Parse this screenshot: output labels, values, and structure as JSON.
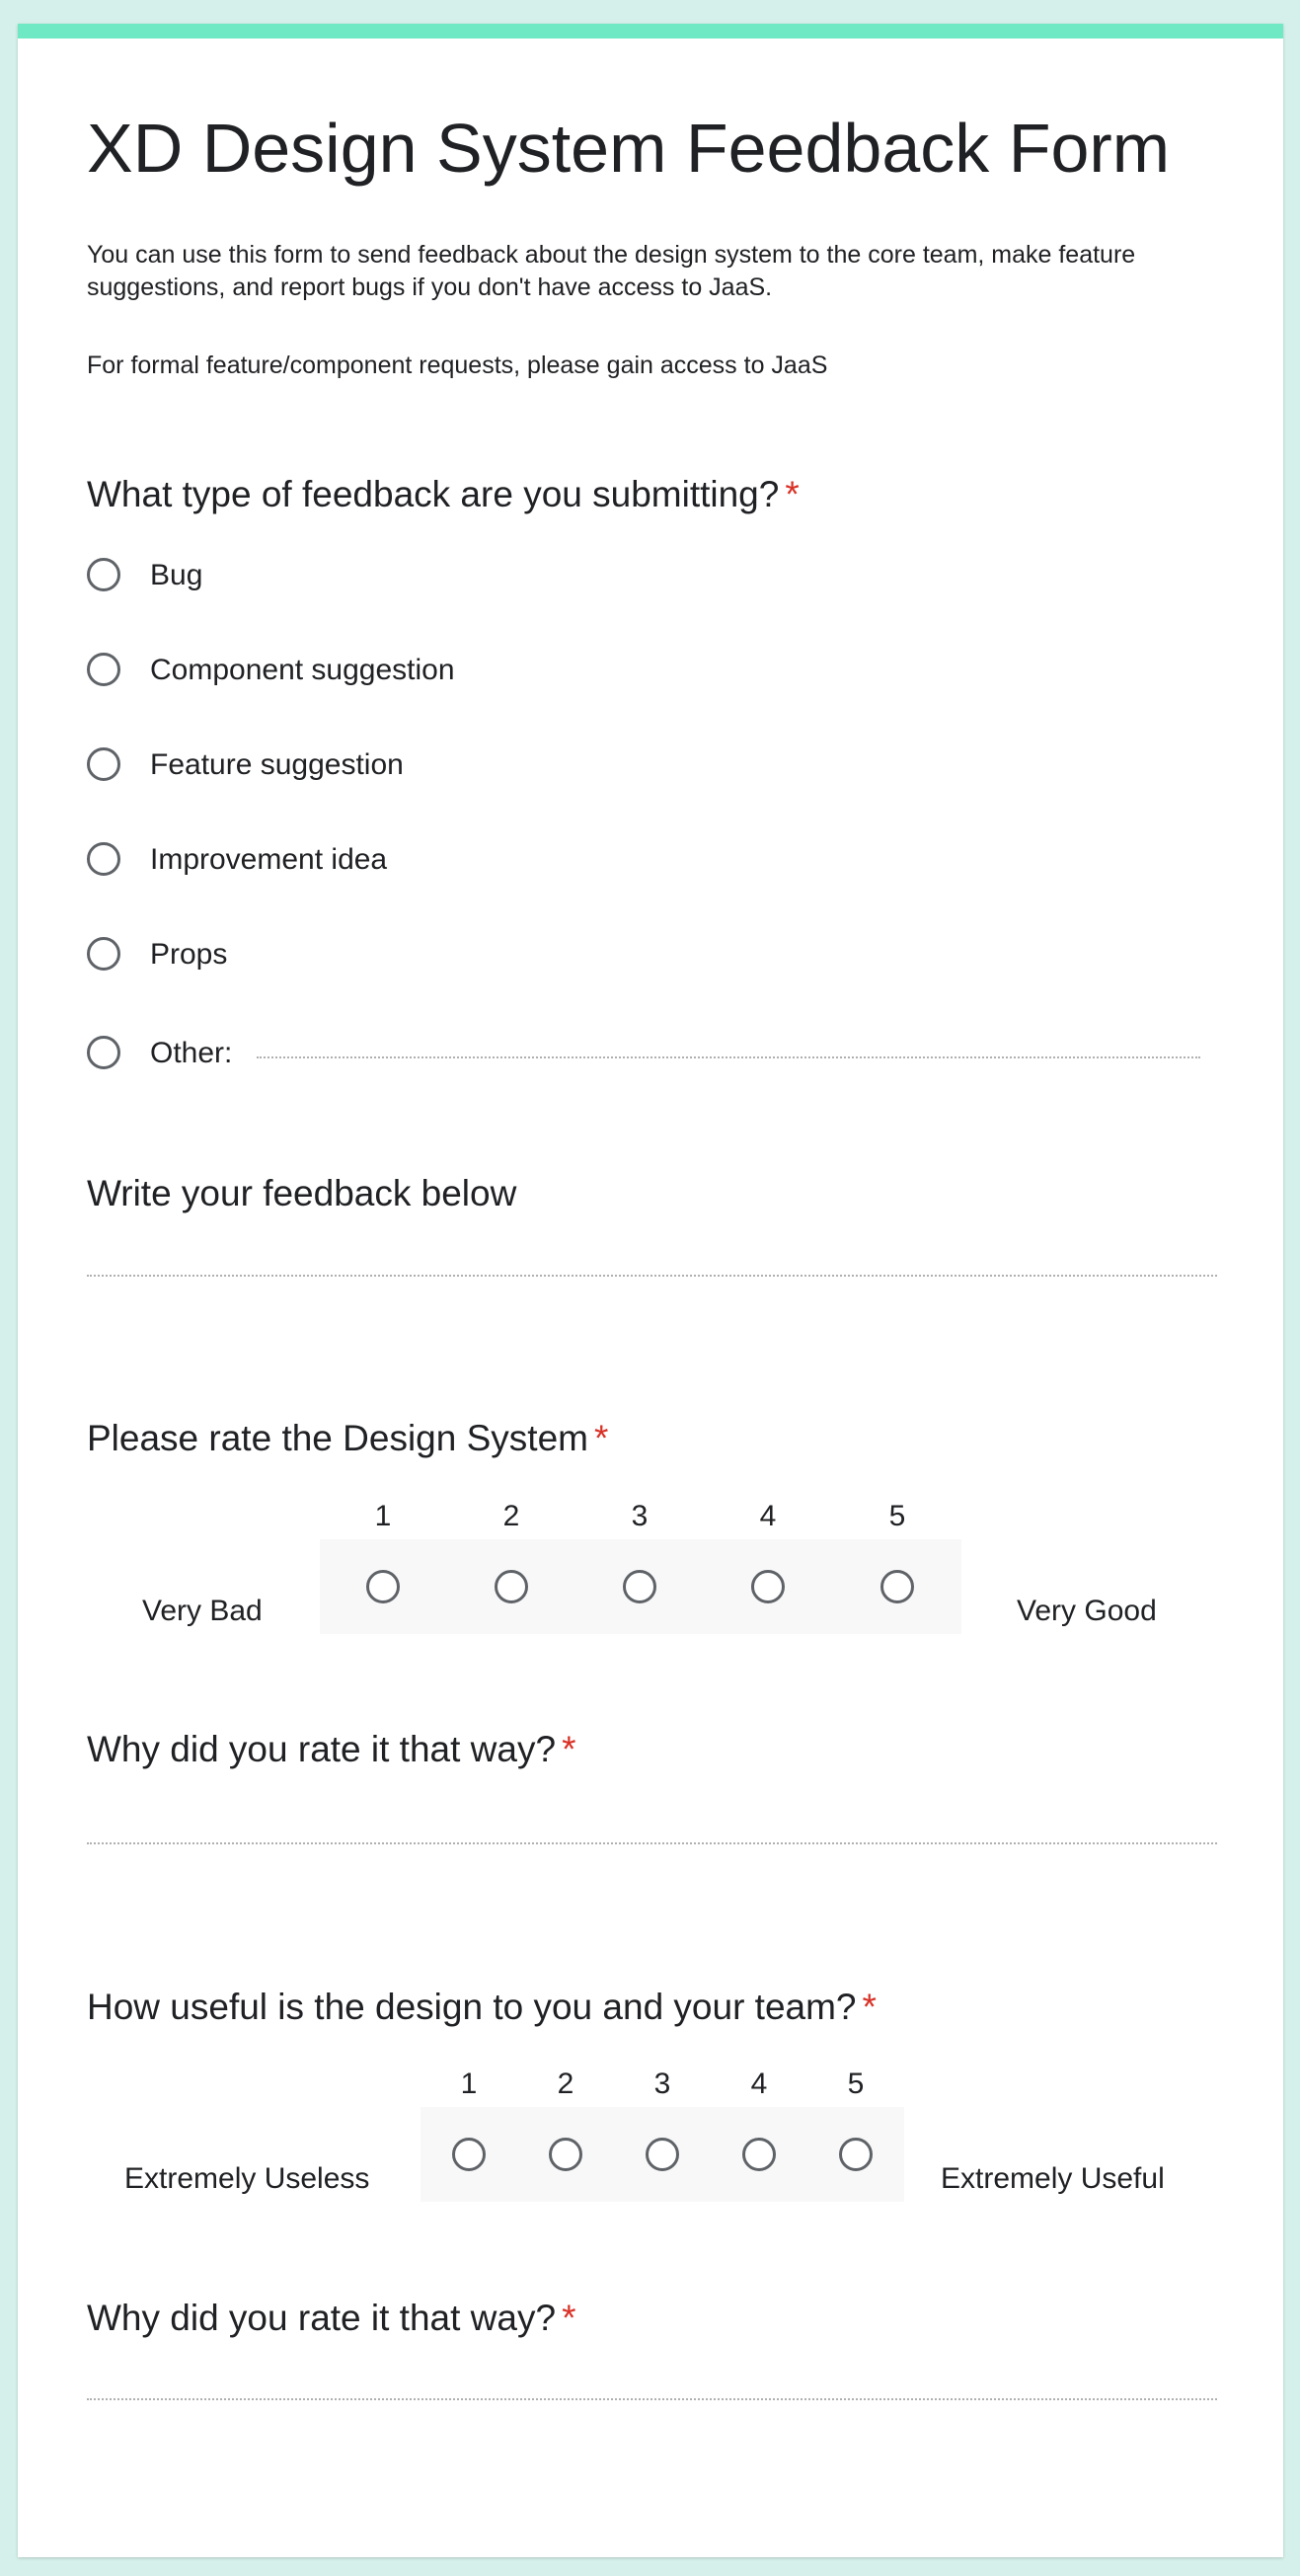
{
  "form": {
    "title": "XD Design System Feedback Form",
    "description_1": "You can use this form to send feedback about the design system to the core team, make feature suggestions, and report bugs if you don't have access to JaaS.",
    "description_2": "For formal feature/component requests, please gain access to JaaS",
    "required_mark": "*"
  },
  "q_type": {
    "title": "What type of feedback are you submitting?",
    "options": [
      "Bug",
      "Component suggestion",
      "Feature suggestion",
      "Improvement idea",
      "Props"
    ],
    "other_label": "Other:",
    "other_value": ""
  },
  "q_feedback": {
    "title": "Write your feedback below",
    "value": ""
  },
  "q_rating": {
    "title": "Please rate the Design System",
    "scale": [
      "1",
      "2",
      "3",
      "4",
      "5"
    ],
    "low_label": "Very Bad",
    "high_label": "Very Good"
  },
  "q_rating_why": {
    "title": "Why did you rate it that way?",
    "value": ""
  },
  "q_useful": {
    "title": "How useful is the design to you and your team?",
    "scale": [
      "1",
      "2",
      "3",
      "4",
      "5"
    ],
    "low_label": "Extremely Useless",
    "high_label": "Extremely Useful"
  },
  "q_useful_why": {
    "title": "Why did you rate it that way?",
    "value": ""
  },
  "colors": {
    "page_background": "#d5f0ea",
    "accent": "#6fe9c3",
    "required": "#d93025",
    "radio_border": "#5f6368"
  }
}
